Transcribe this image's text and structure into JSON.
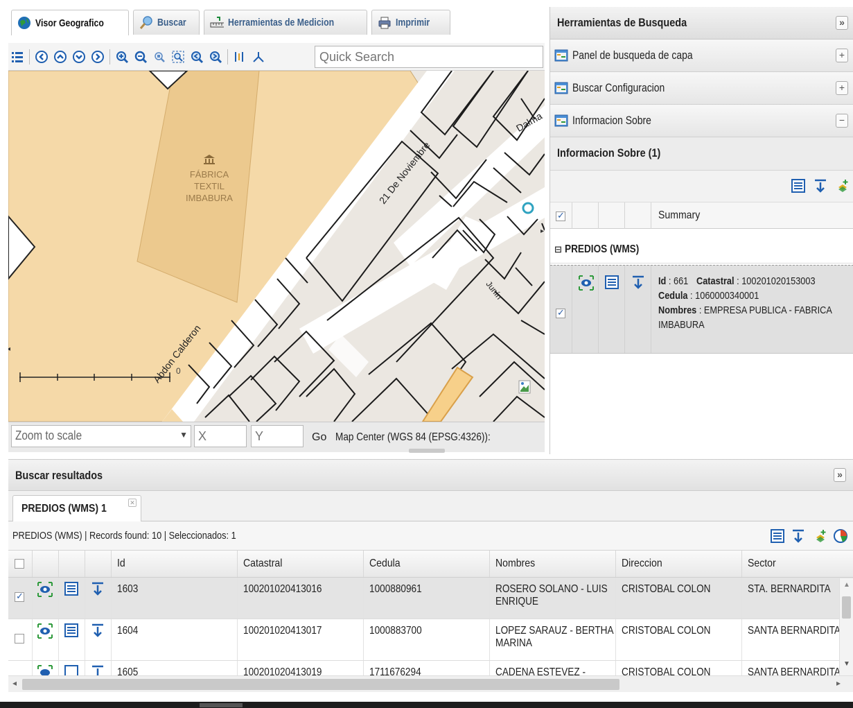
{
  "tabs": [
    {
      "label": "Visor Geografico",
      "icon": "globe-icon",
      "active": true
    },
    {
      "label": "Buscar",
      "icon": "search-icon",
      "active": false
    },
    {
      "label": "Herramientas de Medicion",
      "icon": "ruler-icon",
      "active": false
    },
    {
      "label": "Imprimir",
      "icon": "printer-icon",
      "active": false
    }
  ],
  "toolbar": {
    "quick_search_placeholder": "Quick Search",
    "icons": [
      "layers-icon",
      "pan-left-icon",
      "pan-up-icon",
      "pan-down-icon",
      "pan-right-icon",
      "zoom-in-icon",
      "zoom-out-icon",
      "zoom-box-icon",
      "zoom-extent-icon",
      "zoom-previous-icon",
      "zoom-next-icon",
      "measure-icon",
      "coordinates-icon"
    ]
  },
  "map": {
    "poi_name": "FÁBRICA\nTEXTIL\nIMBABURA",
    "poi_lines": [
      "FÁBRICA",
      "TEXTIL",
      "IMBABURA"
    ],
    "street_labels": [
      "21 De Noviembre",
      "Abdon Calderon",
      "Dalma",
      "Junín"
    ],
    "scale_label": "0",
    "colors": {
      "poi_area": "#f5d9a8",
      "poi_building": "#ecc98e",
      "ground": "#ebe7e1",
      "streets": "#ffffff",
      "highlight": "#f7d08a"
    }
  },
  "map_bottom": {
    "zoom_placeholder": "Zoom to scale",
    "x_placeholder": "X",
    "y_placeholder": "Y",
    "go_label": "Go",
    "center_label": "Map Center (WGS 84 (EPSG:4326)):"
  },
  "right_panel": {
    "title": "Herramientas de Busqueda",
    "collapse_icon": "»",
    "sections": [
      {
        "label": "Panel de busqueda de capa",
        "toggle": "+"
      },
      {
        "label": "Buscar Configuracion",
        "toggle": "+"
      },
      {
        "label": "Informacion Sobre",
        "toggle": "−"
      }
    ],
    "info": {
      "header": "Informacion Sobre (1)",
      "summary_col": "Summary",
      "group": "PREDIOS (WMS)",
      "record": {
        "id_label": "Id",
        "id_value": "661",
        "catastral_label": "Catastral",
        "catastral_value": "100201020153003",
        "cedula_label": "Cedula",
        "cedula_value": "1060000340001",
        "nombres_label": "Nombres",
        "nombres_value": "EMPRESA PUBLICA - FABRICA IMBABURA"
      }
    }
  },
  "results": {
    "title": "Buscar resultados",
    "collapse_icon": "»",
    "tab_label": "PREDIOS (WMS) 1",
    "layer": "PREDIOS (WMS)",
    "records_found": "Records found: 10",
    "selected": "Seleccionados: 1",
    "columns": [
      "Id",
      "Catastral",
      "Cedula",
      "Nombres",
      "Direccion",
      "Sector"
    ],
    "rows": [
      {
        "selected": true,
        "id": "1603",
        "catastral": "100201020413016",
        "cedula": "1000880961",
        "nombres": "ROSERO SOLANO - LUIS ENRIQUE",
        "direccion": "CRISTOBAL COLON",
        "sector": "STA. BERNARDITA"
      },
      {
        "selected": false,
        "id": "1604",
        "catastral": "100201020413017",
        "cedula": "1000883700",
        "nombres": "LOPEZ SARAUZ - BERTHA MARINA",
        "direccion": "CRISTOBAL COLON",
        "sector": "SANTA BERNARDITA"
      },
      {
        "selected": false,
        "id": "1605",
        "catastral": "100201020413019",
        "cedula": "1711676294",
        "nombres": "CADENA ESTEVEZ -",
        "direccion": "CRISTOBAL COLON",
        "sector": "SANTA BERNARDITA"
      }
    ]
  }
}
